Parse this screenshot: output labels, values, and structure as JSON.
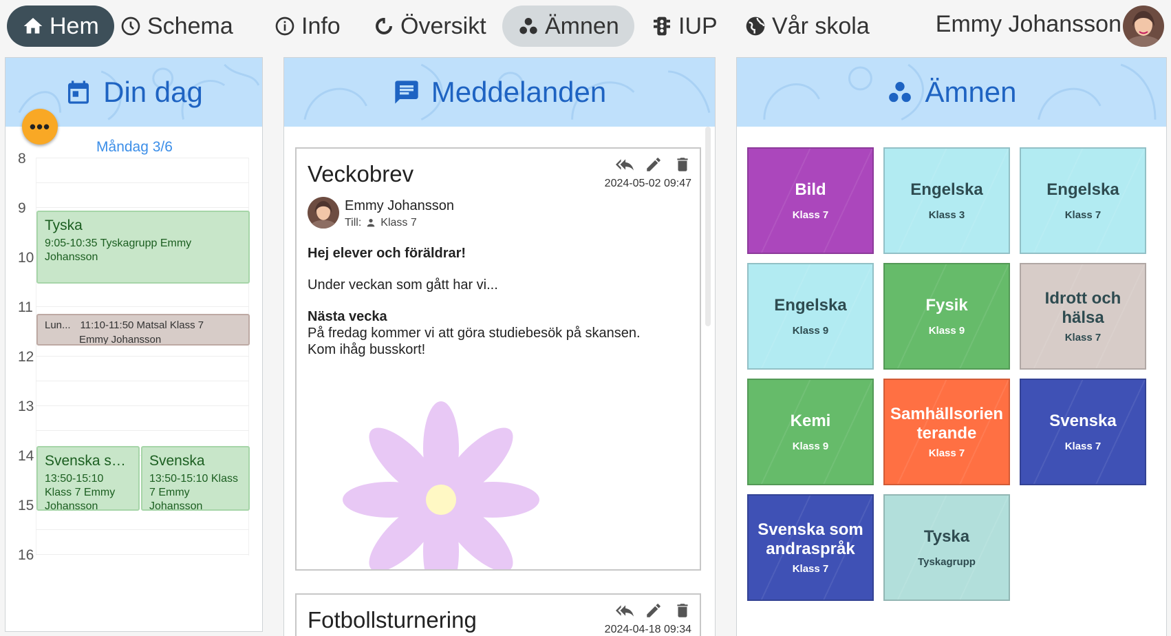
{
  "nav": {
    "items": [
      {
        "label": "Hem",
        "icon": "home-icon"
      },
      {
        "label": "Schema",
        "icon": "clock-icon"
      },
      {
        "label": "Info",
        "icon": "info-icon"
      },
      {
        "label": "Översikt",
        "icon": "refresh-icon"
      },
      {
        "label": "Ämnen",
        "icon": "subjects-icon"
      },
      {
        "label": "IUP",
        "icon": "traffic-light-icon"
      },
      {
        "label": "Vår skola",
        "icon": "globe-icon"
      }
    ],
    "user_name": "Emmy Johansson"
  },
  "day": {
    "title": "Din dag",
    "menu_label": "•••",
    "date": "Måndag 3/6",
    "hours": [
      "8",
      "9",
      "10",
      "11",
      "12",
      "13",
      "14",
      "15",
      "16"
    ],
    "events": [
      {
        "title": "Tyska",
        "info": "9:05-10:35  Tyskagrupp Emmy Johansson"
      },
      {
        "title": "Lun...",
        "time": "11:10-11:50 Matsal Klass 7",
        "extra": "Emmy  Johansson"
      },
      {
        "title": "Svenska so...",
        "info": "13:50-15:10 Klass 7 Emmy Johansson"
      },
      {
        "title": "Svenska",
        "info": "13:50-15:10 Klass 7 Emmy Johansson"
      }
    ]
  },
  "messages": {
    "title": "Meddelanden",
    "items": [
      {
        "title": "Veckobrev",
        "date": "2024-05-02 09:47",
        "author": "Emmy Johansson",
        "to_label": "Till:",
        "to": "Klass 7",
        "greeting": "Hej elever och föräldrar!",
        "intro": "Under veckan som gått har vi...",
        "heading": "Nästa vecka",
        "line1": "På fredag kommer vi att göra studiebesök på skansen.",
        "line2": "Kom ihåg busskort!"
      },
      {
        "title": "Fotbollsturnering",
        "date": "2024-04-18 09:34"
      }
    ]
  },
  "subjects": {
    "title": "Ämnen",
    "tiles": [
      {
        "name": "Bild",
        "class": "Klass 7",
        "color": "#ab47bc"
      },
      {
        "name": "Engelska",
        "class": "Klass 3",
        "color": "#b2ebf2"
      },
      {
        "name": "Engelska",
        "class": "Klass 7",
        "color": "#b2ebf2"
      },
      {
        "name": "Engelska",
        "class": "Klass 9",
        "color": "#b2ebf2"
      },
      {
        "name": "Fysik",
        "class": "Klass 9",
        "color": "#66bb6a"
      },
      {
        "name": "Idrott och hälsa",
        "class": "Klass 7",
        "color": "#d7ccc8"
      },
      {
        "name": "Kemi",
        "class": "Klass 9",
        "color": "#66bb6a"
      },
      {
        "name": "Samhällsorienterande",
        "class": "Klass 7",
        "color": "#ff7043"
      },
      {
        "name": "Svenska",
        "class": "Klass 7",
        "color": "#3f51b5"
      },
      {
        "name": "Svenska som andraspråk",
        "class": "Klass 7",
        "color": "#3f51b5"
      },
      {
        "name": "Tyska",
        "class": "Tyskagrupp",
        "color": "#b2dfdb"
      }
    ]
  }
}
